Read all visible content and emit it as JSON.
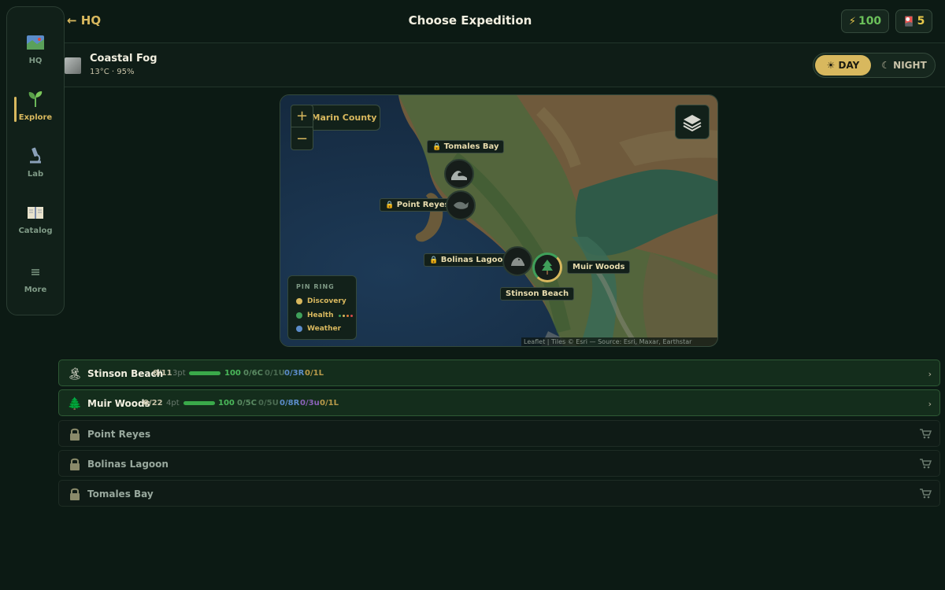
{
  "sidebar": {
    "items": [
      {
        "label": "HQ",
        "icon": "map-icon"
      },
      {
        "label": "Explore",
        "icon": "sprout-icon"
      },
      {
        "label": "Lab",
        "icon": "microscope-icon"
      },
      {
        "label": "Catalog",
        "icon": "book-icon"
      },
      {
        "label": "More",
        "icon": "menu-icon"
      }
    ],
    "active": "Explore"
  },
  "header": {
    "back_label": "← HQ",
    "title": "Choose Expedition",
    "energy_icon": "⚡",
    "energy": "100",
    "cards_icon": "🎴",
    "cards": "5"
  },
  "weather": {
    "title": "Coastal Fog",
    "subtitle": "13°C · 95%"
  },
  "daynight": {
    "day": "☀ DAY",
    "night": "☾ NIGHT",
    "selected": "DAY"
  },
  "map": {
    "region": "Marin County",
    "zoom_in": "+",
    "zoom_out": "−",
    "pins": [
      {
        "name": "Tomales Bay",
        "locked": true,
        "icon": "wave-icon"
      },
      {
        "name": "Point Reyes",
        "locked": true,
        "icon": "whale-icon"
      },
      {
        "name": "Bolinas Lagoon",
        "locked": true,
        "icon": "seal-icon"
      },
      {
        "name": "Muir Woods",
        "locked": false,
        "icon": "tree-icon"
      },
      {
        "name": "Stinson Beach",
        "locked": false,
        "icon": "beach-icon"
      }
    ],
    "lock_glyph": "🔒",
    "legend": {
      "title": "PIN RING",
      "items": [
        {
          "label": "Discovery",
          "color": "#d8b85e"
        },
        {
          "label": "Health",
          "color": "#3fa05a"
        },
        {
          "label": "Weather",
          "color": "#5b8cc9"
        }
      ]
    },
    "attribution": "Leaflet | Tiles © Esri — Source: Esri, Maxar, Earthstar Geographics"
  },
  "expeditions": [
    {
      "name": "Stinson Beach",
      "icon": "🏝",
      "progress": "0/11",
      "points": "3pt",
      "health": "100",
      "health_pct": 100,
      "stats": [
        {
          "text": "0/6C",
          "color": "#5a8a62"
        },
        {
          "text": "0/1U",
          "color": "#4b6b52"
        },
        {
          "text": "0/3R",
          "color": "#5b8cc9"
        },
        {
          "text": "0/1L",
          "color": "#b89a4a"
        }
      ],
      "locked": false
    },
    {
      "name": "Muir Woods",
      "icon": "🌲",
      "progress": "0/22",
      "points": "4pt",
      "health": "100",
      "health_pct": 100,
      "stats": [
        {
          "text": "0/5C",
          "color": "#5a8a62"
        },
        {
          "text": "0/5U",
          "color": "#4b6b52"
        },
        {
          "text": "0/8R",
          "color": "#5b8cc9"
        },
        {
          "text": "0/3u",
          "color": "#8a62b8"
        },
        {
          "text": "0/1L",
          "color": "#b89a4a"
        }
      ],
      "locked": false
    },
    {
      "name": "Point Reyes",
      "locked": true
    },
    {
      "name": "Bolinas Lagoon",
      "locked": true
    },
    {
      "name": "Tomales Bay",
      "locked": true
    }
  ],
  "colors": {
    "accent": "#d8b85e",
    "health": "#3aa94a",
    "bg": "#0c1a14"
  }
}
